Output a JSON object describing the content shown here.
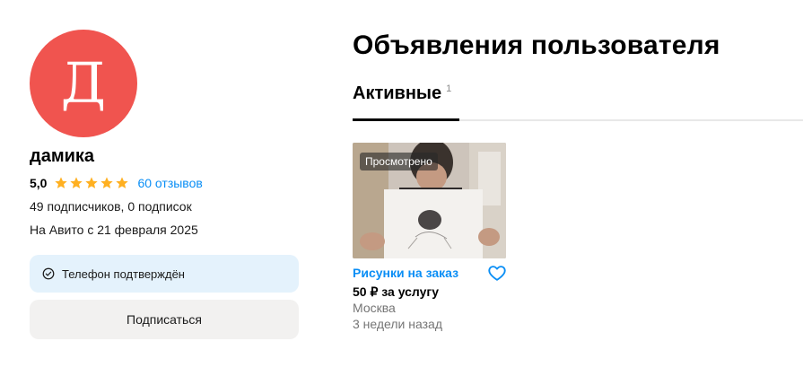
{
  "profile": {
    "avatar_letter": "Д",
    "avatar_color": "#f0544f",
    "name": "дамика",
    "rating": "5,0",
    "stars_filled": 5,
    "reviews_link": "60 отзывов",
    "subscribers_text": "49 подписчиков, 0 подписок",
    "member_since": "На Авито с 21 февраля 2025",
    "phone_verified": "Телефон подтверждён",
    "subscribe_button": "Подписаться"
  },
  "main": {
    "title": "Объявления пользователя",
    "tabs": [
      {
        "label": "Активные",
        "count": "1",
        "active": true
      }
    ]
  },
  "listings": [
    {
      "badge": "Просмотрено",
      "title": "Рисунки на заказ",
      "price": "50 ₽ за услугу",
      "city": "Москва",
      "posted": "3 недели назад",
      "image_icon": "photo-person-holding-drawing",
      "favorite_icon": "heart-outline-icon"
    }
  ],
  "colors": {
    "accent_link": "#0a8ef5",
    "star": "#ffb021",
    "phone_box_bg": "#e4f2fc",
    "button_bg": "#f2f1f0"
  }
}
